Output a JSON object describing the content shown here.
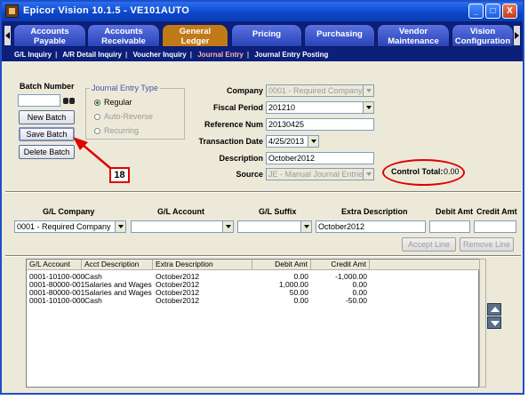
{
  "window": {
    "title": "Epicor Vision 10.1.5 - VE101AUTO",
    "minimize": "_",
    "maximize": "□",
    "close": "X"
  },
  "tabs": [
    {
      "line1": "Accounts",
      "line2": "Payable"
    },
    {
      "line1": "Accounts",
      "line2": "Receivable"
    },
    {
      "line1": "General",
      "line2": "Ledger"
    },
    {
      "line1": "Pricing",
      "line2": ""
    },
    {
      "line1": "Purchasing",
      "line2": ""
    },
    {
      "line1": "Vendor",
      "line2": "Maintenance"
    },
    {
      "line1": "Vision",
      "line2": "Configuration"
    }
  ],
  "subnav": [
    "G/L Inquiry",
    "A/R Detail Inquiry",
    "Voucher Inquiry",
    "Journal Entry",
    "Journal Entry Posting"
  ],
  "batch": {
    "label": "Batch Number",
    "value": "",
    "new_button": "New Batch",
    "save_button": "Save Batch",
    "delete_button": "Delete Batch"
  },
  "journal_type": {
    "title": "Journal Entry Type",
    "options": [
      "Regular",
      "Auto-Reverse",
      "Recurring"
    ],
    "selected": "Regular"
  },
  "form": {
    "company_label": "Company",
    "company_value": "0001 - Required Company",
    "fiscal_label": "Fiscal Period",
    "fiscal_value": "201210",
    "refnum_label": "Reference Num",
    "refnum_value": "20130425",
    "trandate_label": "Transaction Date",
    "trandate_value": "4/25/2013",
    "desc_label": "Description",
    "desc_value": "October2012",
    "source_label": "Source",
    "source_value": "JE - Manual Journal Entries",
    "control_total_label": "Control Total:",
    "control_total_value": "0.00"
  },
  "callout": {
    "number": "18"
  },
  "line_entry": {
    "headers": {
      "company": "G/L Company",
      "account": "G/L Account",
      "suffix": "G/L Suffix",
      "extra": "Extra Description",
      "debit": "Debit Amt",
      "credit": "Credit Amt"
    },
    "company_value": "0001 - Required Company",
    "account_value": "",
    "suffix_value": "",
    "extra_value": "October2012",
    "debit_value": "",
    "credit_value": "",
    "accept_button": "Accept Line",
    "remove_button": "Remove Line"
  },
  "grid": {
    "columns": [
      "G/L Account",
      "Acct Description",
      "Extra Description",
      "Debit Amt",
      "Credit Amt"
    ],
    "rows": [
      [
        "0001-10100-000",
        "Cash",
        "October2012",
        "0.00",
        "-1,000.00"
      ],
      [
        "0001-80000-001",
        "Salaries and Wages",
        "October2012",
        "1,000.00",
        "0.00"
      ],
      [
        "0001-80000-001",
        "Salaries and Wages",
        "October2012",
        "50.00",
        "0.00"
      ],
      [
        "0001-10100-000",
        "Cash",
        "October2012",
        "0.00",
        "-50.00"
      ]
    ]
  }
}
